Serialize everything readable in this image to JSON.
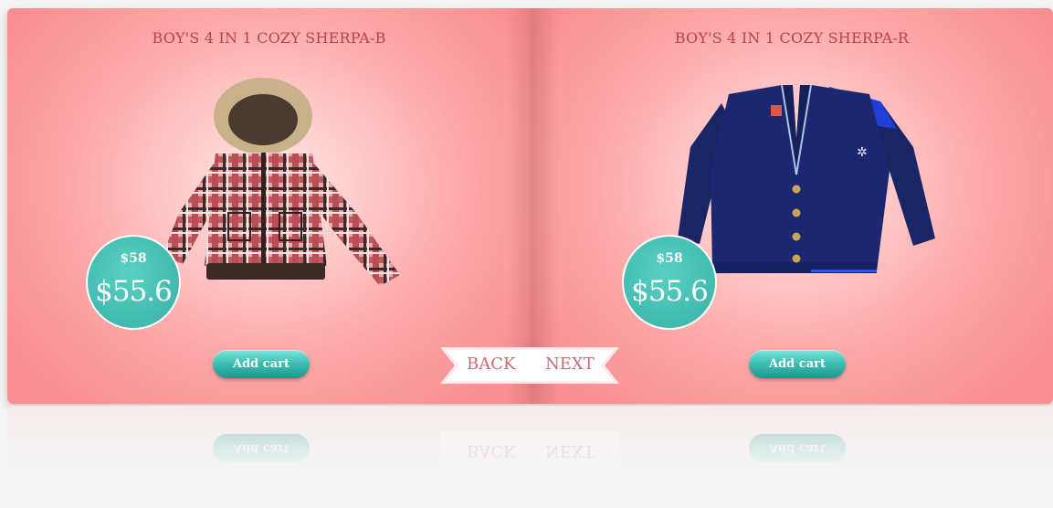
{
  "products": [
    {
      "title": "BOY'S 4 IN 1 COZY SHERPA-B",
      "old_price": "$58",
      "price": "$55.6",
      "button": "Add cart",
      "image": "plaid-hooded-jacket"
    },
    {
      "title": "BOY'S 4 IN 1 COZY SHERPA-R",
      "old_price": "$58",
      "price": "$55.6",
      "button": "Add cart",
      "image": "navy-cardigan"
    }
  ],
  "nav": {
    "back": "BACK",
    "next": "NEXT"
  },
  "colors": {
    "page_pink": "#fda8a8",
    "title_red": "#b8434c",
    "price_teal": "#3ec0b4",
    "ribbon_text": "#d06a72"
  }
}
